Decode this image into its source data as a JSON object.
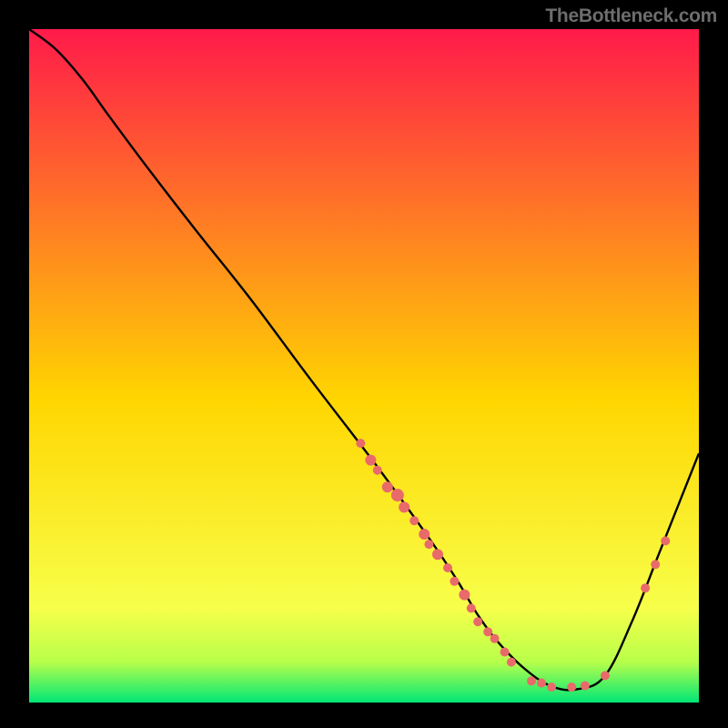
{
  "attribution": "TheBottleneck.com",
  "colors": {
    "grad_top": "#ff1a4a",
    "grad_mid": "#ffd600",
    "grad_low1": "#f7ff4a",
    "grad_low2": "#b7ff4a",
    "grad_bottom": "#00e676",
    "curve": "#000000",
    "dot_fill": "#e96a6a",
    "dot_stroke": "#c75050",
    "page_bg": "#000000"
  },
  "chart_data": {
    "type": "line",
    "xlabel": "",
    "ylabel": "",
    "xlim": [
      0,
      100
    ],
    "ylim": [
      0,
      100
    ],
    "title": "",
    "series": [
      {
        "name": "bottleneck-curve",
        "x": [
          0,
          4,
          8,
          12,
          18,
          25,
          33,
          42,
          52,
          60,
          64,
          67,
          70,
          74,
          78,
          82,
          86,
          90,
          94,
          98,
          100
        ],
        "y": [
          100,
          97,
          92.5,
          87,
          79,
          70,
          60,
          48,
          35,
          24,
          18,
          13,
          9,
          5,
          2.4,
          2,
          4,
          12,
          22,
          32,
          37
        ]
      }
    ],
    "dots": [
      {
        "x": 49.5,
        "y": 38.5,
        "r": 5
      },
      {
        "x": 51,
        "y": 36,
        "r": 6
      },
      {
        "x": 52,
        "y": 34.5,
        "r": 5
      },
      {
        "x": 53.5,
        "y": 32,
        "r": 6
      },
      {
        "x": 55,
        "y": 30.8,
        "r": 7
      },
      {
        "x": 56,
        "y": 29,
        "r": 6
      },
      {
        "x": 57.5,
        "y": 27,
        "r": 5
      },
      {
        "x": 59,
        "y": 25,
        "r": 6
      },
      {
        "x": 59.7,
        "y": 23.5,
        "r": 5
      },
      {
        "x": 61,
        "y": 22,
        "r": 6
      },
      {
        "x": 62.5,
        "y": 20,
        "r": 5
      },
      {
        "x": 63.5,
        "y": 18,
        "r": 5
      },
      {
        "x": 65,
        "y": 16,
        "r": 6
      },
      {
        "x": 66,
        "y": 14,
        "r": 5
      },
      {
        "x": 67,
        "y": 12,
        "r": 5
      },
      {
        "x": 68.5,
        "y": 10.5,
        "r": 5
      },
      {
        "x": 69.5,
        "y": 9.5,
        "r": 5
      },
      {
        "x": 71,
        "y": 7.5,
        "r": 5
      },
      {
        "x": 72,
        "y": 6,
        "r": 5
      },
      {
        "x": 75,
        "y": 3.2,
        "r": 5
      },
      {
        "x": 76.5,
        "y": 2.9,
        "r": 5
      },
      {
        "x": 78,
        "y": 2.3,
        "r": 5
      },
      {
        "x": 81,
        "y": 2.3,
        "r": 5
      },
      {
        "x": 83,
        "y": 2.5,
        "r": 5
      },
      {
        "x": 86,
        "y": 4,
        "r": 5
      },
      {
        "x": 92,
        "y": 17,
        "r": 5
      },
      {
        "x": 93.5,
        "y": 20.5,
        "r": 5
      },
      {
        "x": 95,
        "y": 24,
        "r": 5
      }
    ]
  }
}
